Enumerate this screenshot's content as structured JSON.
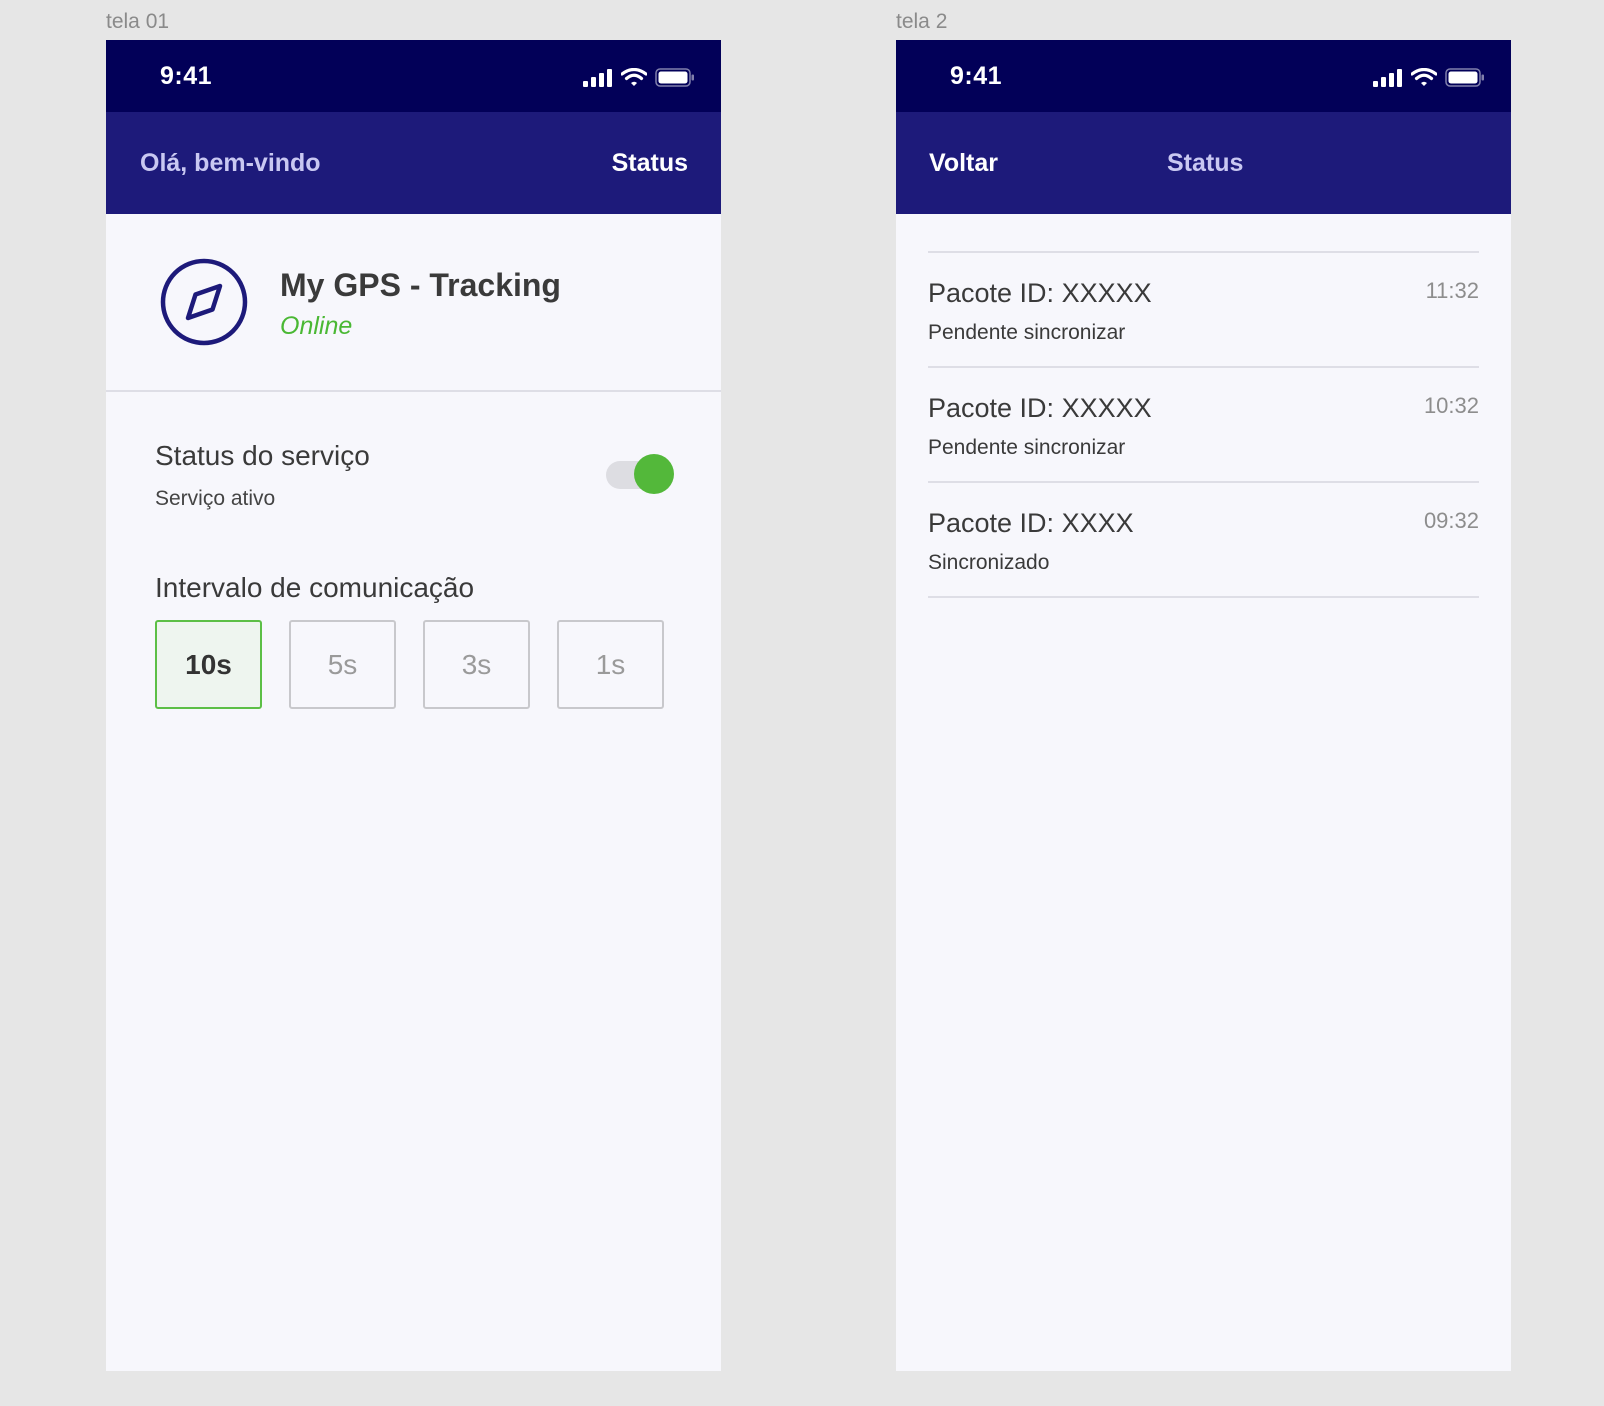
{
  "screens": [
    {
      "frame_label": "tela 01",
      "status_bar": {
        "time": "9:41"
      },
      "navbar": {
        "left": "Olá, bem-vindo",
        "right": "Status"
      },
      "app": {
        "title": "My GPS - Tracking",
        "status": "Online",
        "logo_icon": "compass-icon"
      },
      "service": {
        "title": "Status do serviço",
        "subtitle": "Serviço ativo",
        "toggle_on": true
      },
      "interval": {
        "title": "Intervalo de comunicação",
        "options": [
          "10s",
          "5s",
          "3s",
          "1s"
        ],
        "selected": "10s"
      }
    },
    {
      "frame_label": "tela 2",
      "status_bar": {
        "time": "9:41"
      },
      "navbar": {
        "left": "Voltar",
        "center": "Status"
      },
      "packages": [
        {
          "id": "Pacote ID: XXXXX",
          "state": "Pendente sincronizar",
          "time": "11:32"
        },
        {
          "id": "Pacote ID: XXXXX",
          "state": "Pendente sincronizar",
          "time": "10:32"
        },
        {
          "id": "Pacote ID: XXXX",
          "state": "Sincronizado",
          "time": "09:32"
        }
      ]
    }
  ],
  "colors": {
    "status_bar_bg": "#020058",
    "navbar_bg": "#1d1a7a",
    "accent_green": "#53b83a",
    "nav_muted_text": "#c9c8f2"
  }
}
